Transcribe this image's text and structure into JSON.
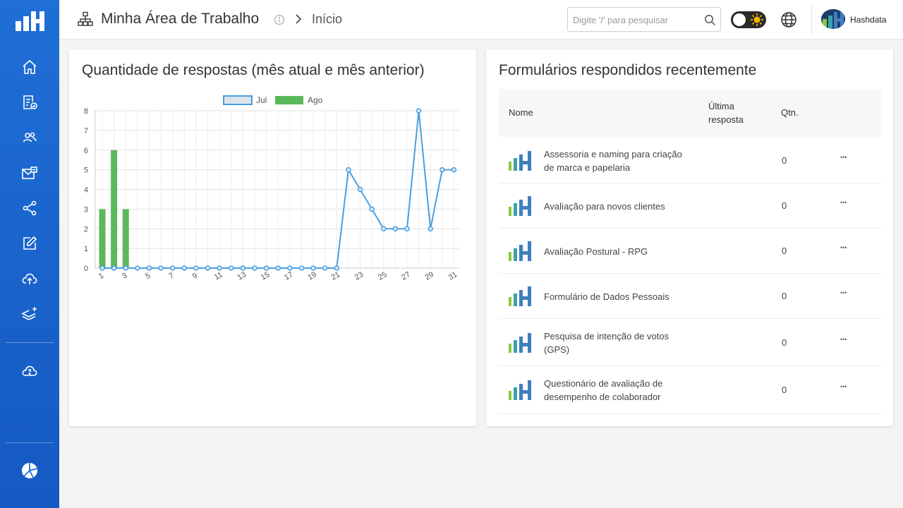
{
  "header": {
    "title": "Minha Área de Trabalho",
    "breadcrumb": "Início",
    "search_placeholder": "Digite '/' para pesquisar",
    "user_name": "Hashdata"
  },
  "sidebar": {
    "items": [
      "home-icon",
      "forms-icon",
      "users-icon",
      "mail-icon",
      "share-icon",
      "edit-icon",
      "cloud-upload-icon",
      "layers-icon",
      "cloud-help-icon"
    ],
    "accent": "#1f6fd6"
  },
  "chart_card": {
    "title": "Quantidade de respostas (mês atual e mês anterior)"
  },
  "chart_data": {
    "type": "bar+line",
    "categories": [
      1,
      2,
      3,
      4,
      5,
      6,
      7,
      8,
      9,
      10,
      11,
      12,
      13,
      14,
      15,
      16,
      17,
      18,
      19,
      20,
      21,
      22,
      23,
      24,
      25,
      26,
      27,
      28,
      29,
      30,
      31
    ],
    "x_tick_labels": [
      "1",
      "3",
      "5",
      "7",
      "9",
      "11",
      "13",
      "15",
      "17",
      "19",
      "21",
      "23",
      "25",
      "27",
      "29",
      "31"
    ],
    "series": [
      {
        "name": "Jul",
        "type": "line",
        "color": "#4a9fe0",
        "values": [
          0,
          0,
          0,
          0,
          0,
          0,
          0,
          0,
          0,
          0,
          0,
          0,
          0,
          0,
          0,
          0,
          0,
          0,
          0,
          0,
          0,
          5,
          4,
          3,
          2,
          2,
          2,
          8,
          2,
          5,
          5
        ]
      },
      {
        "name": "Ago",
        "type": "bar",
        "color": "#5cb85c",
        "values": [
          3,
          6,
          3,
          0,
          0,
          0,
          0,
          0,
          0,
          0,
          0,
          0,
          0,
          0,
          0,
          0,
          0,
          0,
          0,
          0,
          0,
          0,
          0,
          0,
          0,
          0,
          0,
          0,
          0,
          0,
          0
        ]
      }
    ],
    "ylim": [
      0,
      8
    ],
    "y_ticks": [
      0,
      1,
      2,
      3,
      4,
      5,
      6,
      7,
      8
    ],
    "legend_position": "top",
    "grid": true
  },
  "forms_card": {
    "title": "Formulários respondidos recentemente",
    "columns": {
      "name": "Nome",
      "last_line1": "Última",
      "last_line2": "resposta",
      "qtn": "Qtn."
    },
    "rows": [
      {
        "name": "Assessoria e naming para criação de marca e papelaria",
        "qtn": "0",
        "more": "•••"
      },
      {
        "name": "Avaliação para novos clientes",
        "qtn": "0",
        "more": "•••"
      },
      {
        "name": "Avaliação Postural - RPG",
        "qtn": "0",
        "more": "•••"
      },
      {
        "name": "Formulário de Dados Pessoais",
        "qtn": "0",
        "more": "•••"
      },
      {
        "name": "Pesquisa de intenção de votos (GPS)",
        "qtn": "0",
        "more": "•••"
      },
      {
        "name": "Questionário de avaliação de desempenho de colaborador",
        "qtn": "0",
        "more": "•••"
      }
    ]
  }
}
